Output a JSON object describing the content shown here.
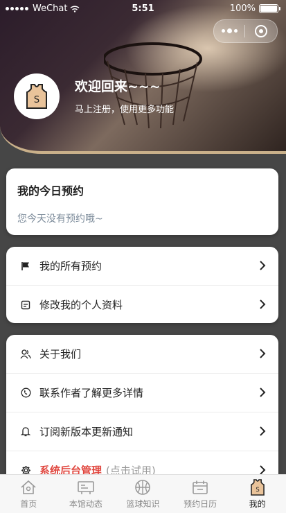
{
  "status_bar": {
    "carrier": "WeChat",
    "time": "5:51",
    "battery": "100%"
  },
  "profile": {
    "welcome": "欢迎回来~~~",
    "subtitle": "马上注册，使用更多功能"
  },
  "today": {
    "title": "我的今日预约",
    "empty_text": "您今天没有预约哦~"
  },
  "menu1": [
    {
      "label": "我的所有预约",
      "icon": "flag-icon"
    },
    {
      "label": "修改我的个人资料",
      "icon": "edit-icon"
    }
  ],
  "menu2": [
    {
      "label": "关于我们",
      "icon": "users-icon"
    },
    {
      "label": "联系作者了解更多详情",
      "icon": "phone-icon"
    },
    {
      "label": "订阅新版本更新通知",
      "icon": "bell-icon"
    },
    {
      "label": "系统后台管理",
      "extra": "(点击试用)",
      "icon": "gear-icon"
    }
  ],
  "tabs": [
    {
      "label": "首页",
      "icon": "home-icon",
      "active": false
    },
    {
      "label": "本馆动态",
      "icon": "news-icon",
      "active": false
    },
    {
      "label": "篮球知识",
      "icon": "basketball-icon",
      "active": false
    },
    {
      "label": "预约日历",
      "icon": "calendar-icon",
      "active": false
    },
    {
      "label": "我的",
      "icon": "jersey-icon",
      "active": true
    }
  ],
  "colors": {
    "accent_red": "#e0463e",
    "card_bg": "#ffffff",
    "page_bg": "#464646",
    "tab_bar_bg": "#f7f7f7"
  }
}
